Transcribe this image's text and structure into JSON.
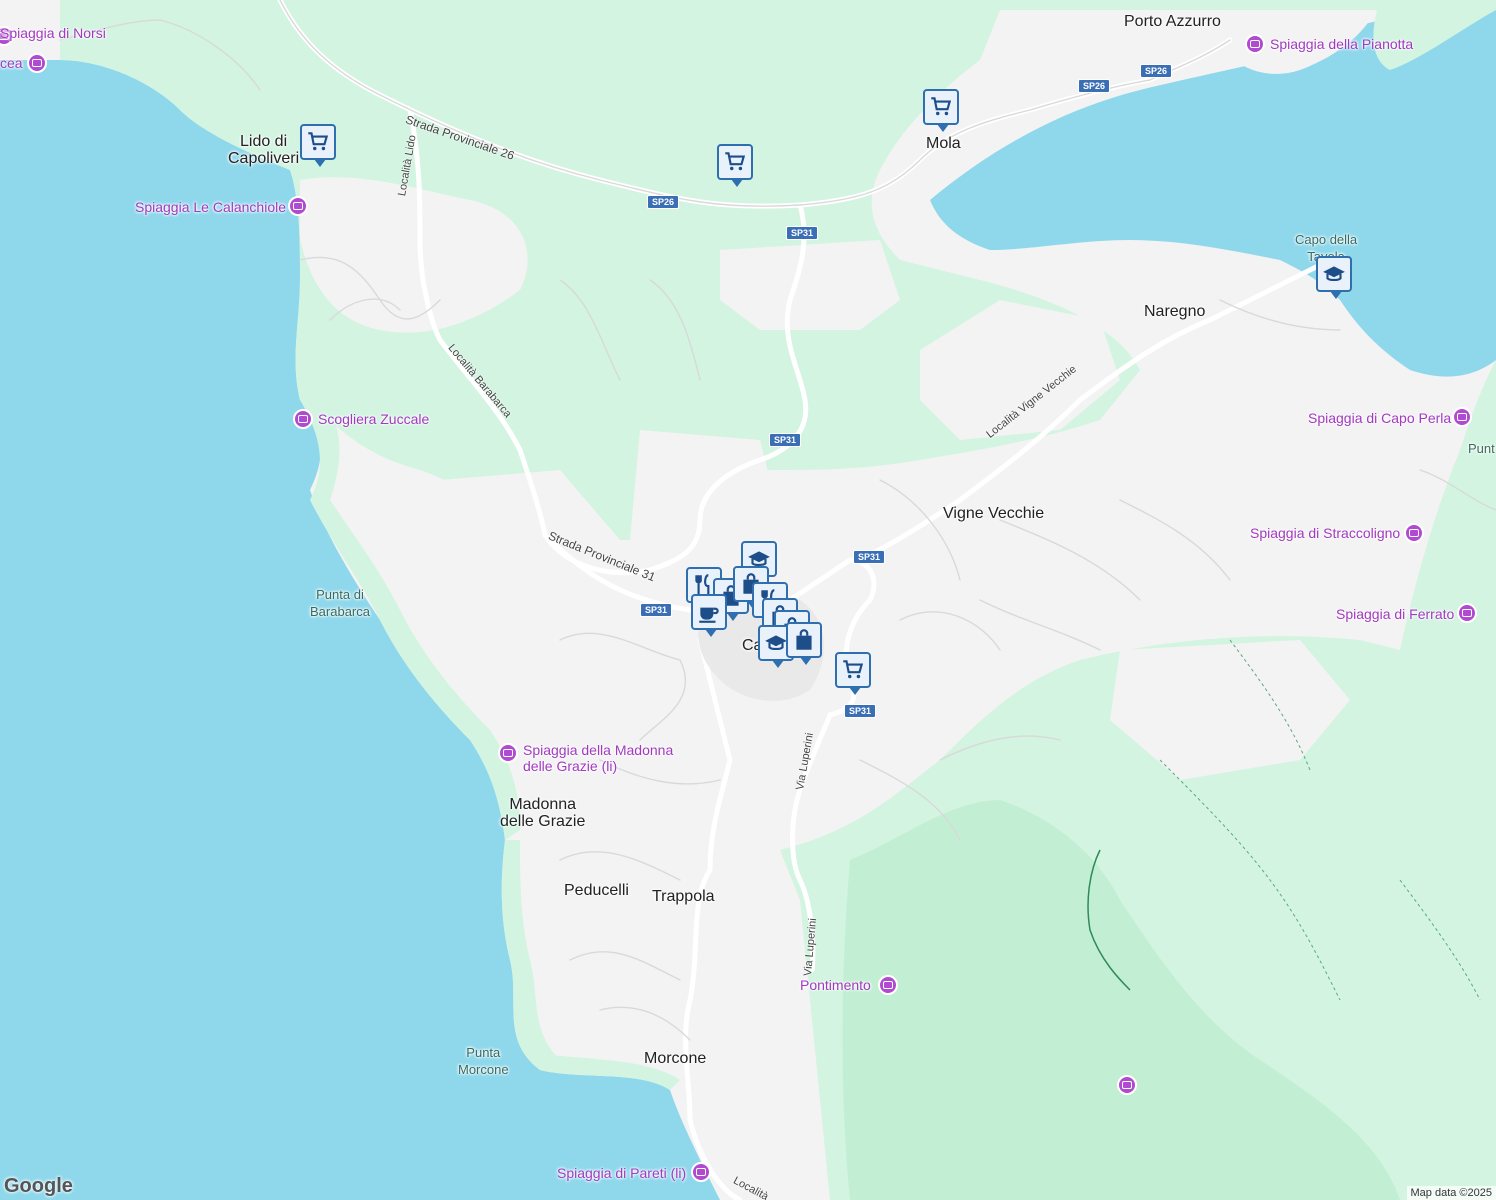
{
  "map": {
    "attribution": "Map data ©2025",
    "logo": "Google",
    "colors": {
      "water": "#8fd8ec",
      "land": "#f4f4f4",
      "park": "#d2f4e1",
      "forest": "#c2efd4",
      "poi": "#a23ac0",
      "marker": "#2f6fb0"
    }
  },
  "towns": {
    "porto_azzurro": "Porto Azzurro",
    "lido_di_capoliveri": "Lido di\nCapoliveri",
    "mola": "Mola",
    "naregno": "Naregno",
    "vigne_vecchie": "Vigne Vecchie",
    "capoliveri": "Ca",
    "madonna_delle_grazie": "Madonna\ndelle Grazie",
    "peducelli": "Peducelli",
    "trappola": "Trappola",
    "morcone": "Morcone",
    "capo_della_tavola": "Capo della\nTavola",
    "punta_di_barabarca": "Punta di\nBarabarca",
    "punta_morcone": "Punta\nMorcone",
    "punt": "Punt"
  },
  "pois": {
    "spiaggia_di_norsi": "Spiaggia di Norsi",
    "cea": "cea",
    "spiaggia_della_pianotta": "Spiaggia della Pianotta",
    "spiaggia_le_calanchiole": "Spiaggia Le Calanchiole",
    "scogliera_zuccale": "Scogliera Zuccale",
    "spiaggia_di_capo_perla": "Spiaggia di Capo Perla",
    "spiaggia_di_straccoligno": "Spiaggia di Straccoligno",
    "spiaggia_di_ferrato": "Spiaggia di Ferrato",
    "spiaggia_madonna_delle_grazie": "Spiaggia della Madonna\ndelle Grazie (li)",
    "pontimento": "Pontimento",
    "spiaggia_di_pareti": "Spiaggia di Pareti (li)"
  },
  "roads": {
    "sp26_name": "Strada Provinciale 26",
    "sp31_name": "Strada Provinciale 31",
    "localita_lido": "Località Lido",
    "localita_barabarca": "Località Barabarca",
    "localita_vigne_vecchie": "Località Vigne Vecchie",
    "via_luperini_1": "Via Luperini",
    "via_luperini_2": "Via Luperini",
    "localita_bottom": "Località",
    "shield_sp26": "SP26",
    "shield_sp31": "SP31"
  },
  "markers": {
    "shopping_cart": "shopping-cart-icon",
    "school": "school-icon",
    "coffee": "coffee-icon",
    "restaurant": "restaurant-icon",
    "shopping_bag": "shopping-bag-icon"
  }
}
